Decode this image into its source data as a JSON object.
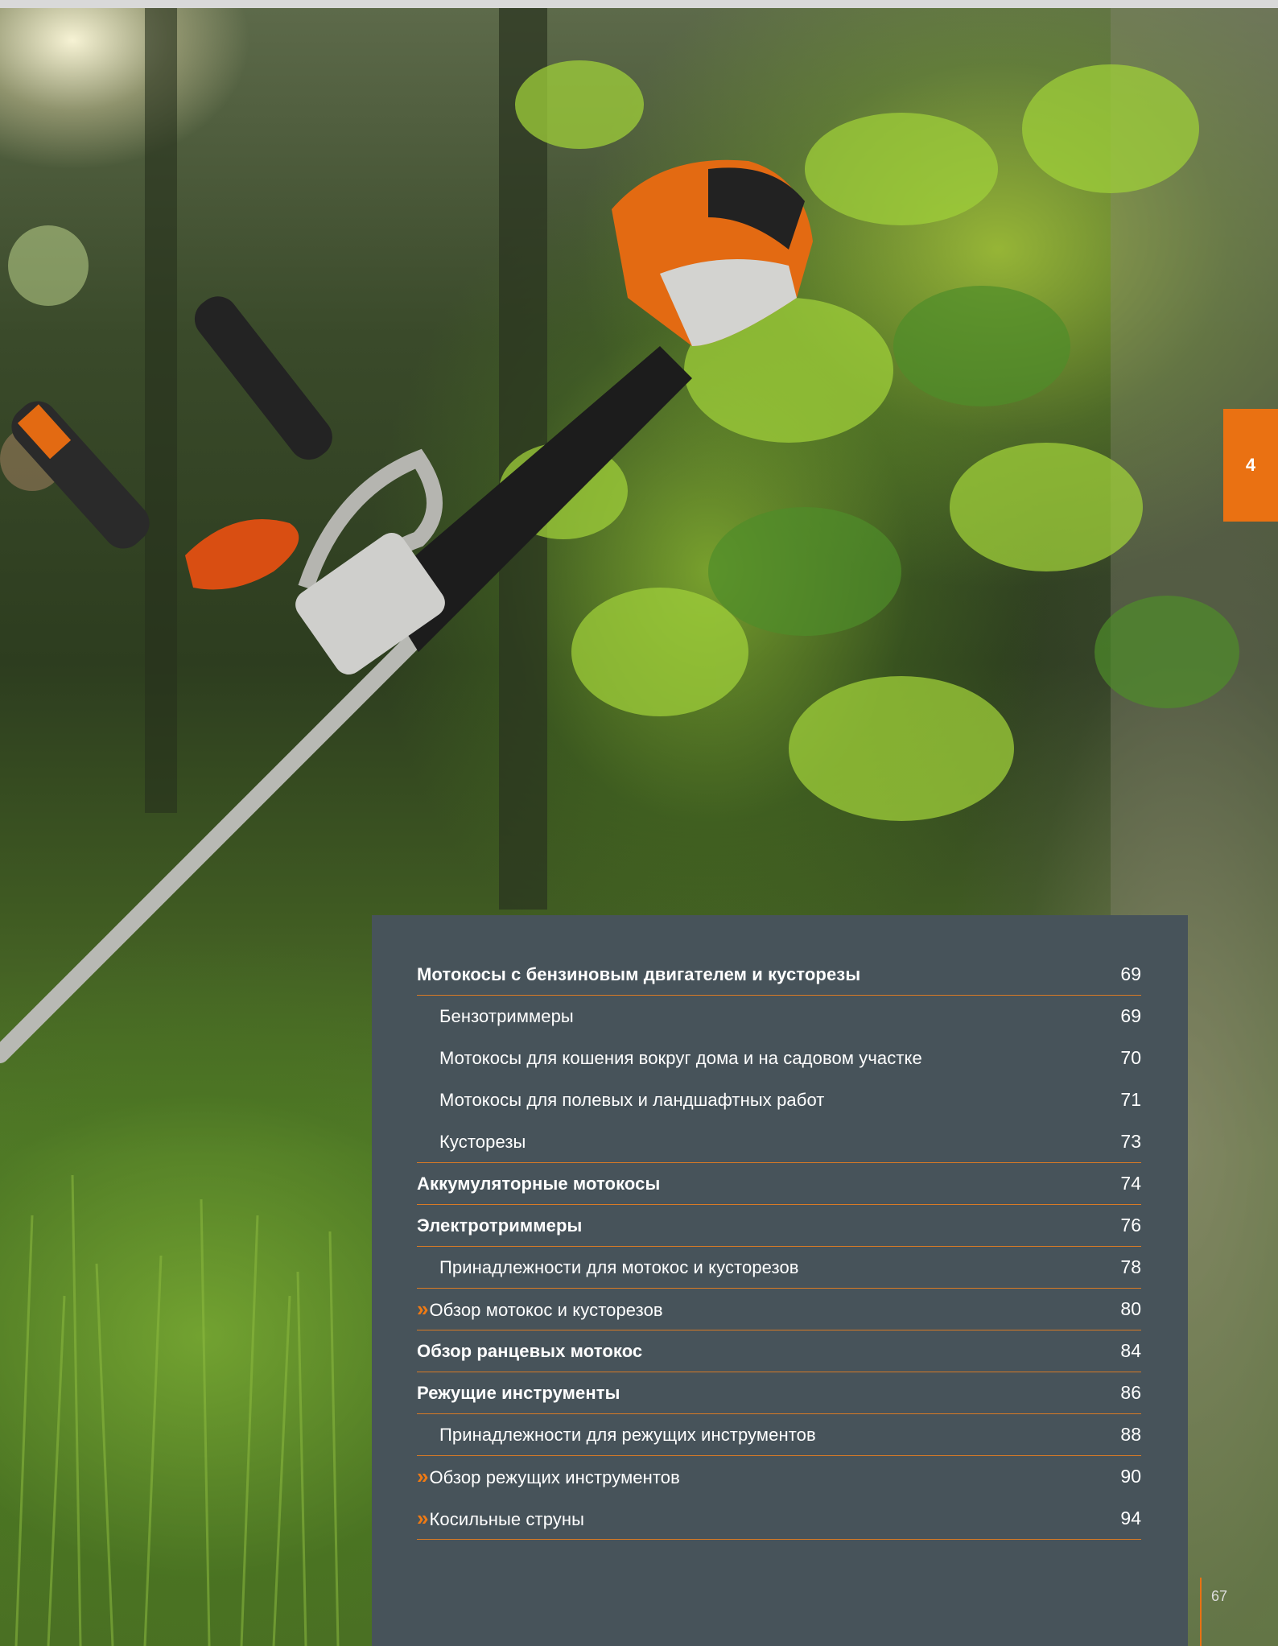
{
  "section_tab": "4",
  "toc": [
    {
      "title": "Мотокосы с бензиновым двигателем и кусторезы",
      "page": "69",
      "level": "main",
      "arrow": false
    },
    {
      "title": "Бензотриммеры",
      "page": "69",
      "level": "sub",
      "arrow": false
    },
    {
      "title": "Мотокосы для кошения вокруг дома и на садовом участке",
      "page": "70",
      "level": "sub",
      "arrow": false
    },
    {
      "title": "Мотокосы для полевых и ландшафтных работ",
      "page": "71",
      "level": "sub",
      "arrow": false
    },
    {
      "title": "Кусторезы",
      "page": "73",
      "level": "sub",
      "arrow": false
    },
    {
      "title": "Аккумуляторные мотокосы",
      "page": "74",
      "level": "main",
      "arrow": false
    },
    {
      "title": "Электротриммеры",
      "page": "76",
      "level": "main",
      "arrow": false
    },
    {
      "title": "Принадлежности для мотокос и кусторезов",
      "page": "78",
      "level": "sub",
      "arrow": false
    },
    {
      "title": "Обзор мотокос и кусторезов",
      "page": "80",
      "level": "arrow",
      "arrow": true
    },
    {
      "title": "Обзор ранцевых мотокос",
      "page": "84",
      "level": "main",
      "arrow": false
    },
    {
      "title": "Режущие инструменты",
      "page": "86",
      "level": "main",
      "arrow": false
    },
    {
      "title": "Принадлежности для режущих инструментов",
      "page": "88",
      "level": "sub",
      "arrow": false
    },
    {
      "title": "Обзор режущих инструментов",
      "page": "90",
      "level": "arrow",
      "arrow": true
    },
    {
      "title": "Косильные струны",
      "page": "94",
      "level": "arrow",
      "arrow": true
    }
  ],
  "arrow_glyph": "»",
  "page_number": "67",
  "colors": {
    "accent": "#ea7112",
    "panel": "#47535a"
  }
}
